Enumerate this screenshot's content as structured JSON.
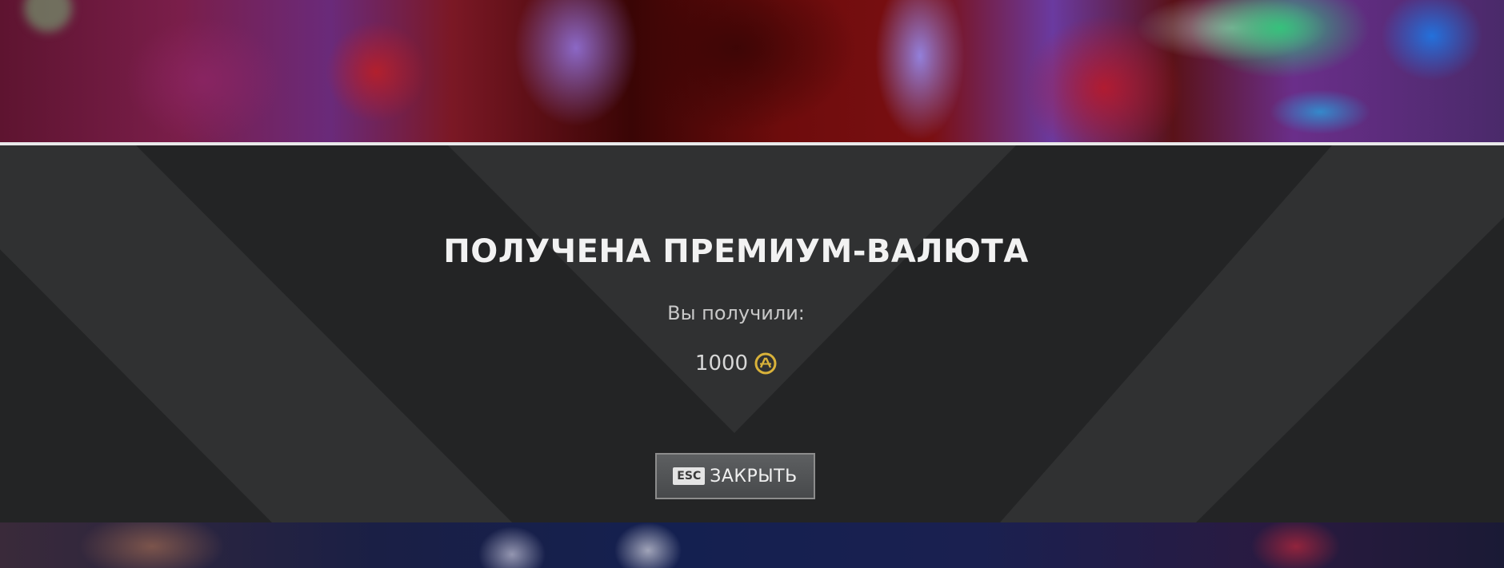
{
  "dialog": {
    "title": "ПОЛУЧЕНА ПРЕМИУМ-ВАЛЮТА",
    "subtitle": "Вы получили:",
    "reward": {
      "amount": "1000",
      "currency_icon": "apex-coins-icon"
    },
    "close_button": {
      "key": "ESC",
      "label": "ЗАКРЫТЬ"
    }
  },
  "colors": {
    "panel_background": "#232425",
    "stripe_light": "#303132",
    "rule": "#e9e9ea",
    "coin_gold": "#d9b23a",
    "title_text": "#f2f2f2"
  }
}
